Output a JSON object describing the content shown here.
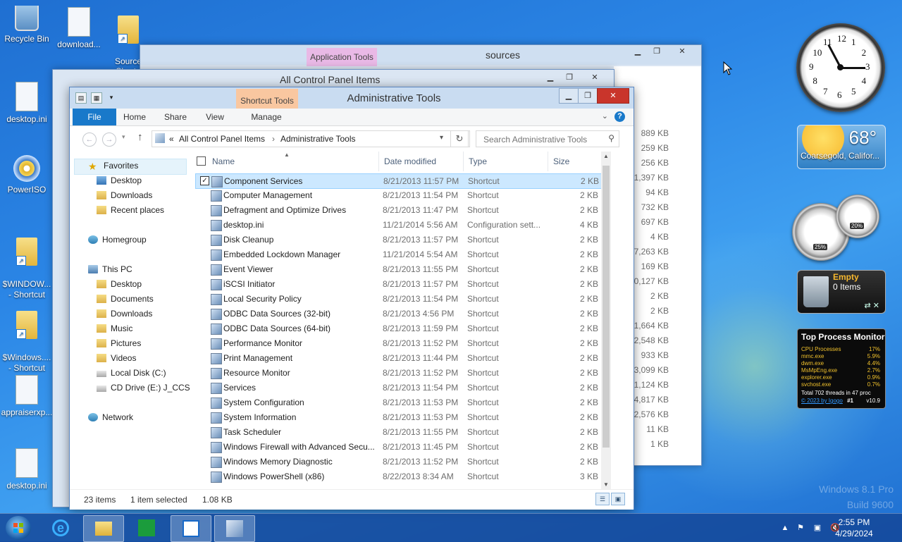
{
  "desktop": {
    "icons": [
      {
        "label": "Recycle Bin"
      },
      {
        "label": "download..."
      },
      {
        "label": "Source\nShorto"
      },
      {
        "label": "desktop.ini"
      },
      {
        "label": "PowerISO"
      },
      {
        "label": "$WINDOW...\n- Shortcut"
      },
      {
        "label": "$Windows....\n- Shortcut"
      },
      {
        "label": "appraiserxp..."
      },
      {
        "label": "desktop.ini"
      }
    ],
    "watermark_line1": "Windows 8.1 Pro",
    "watermark_line2": "Build 9600"
  },
  "bg_window_sources": {
    "tool_tab": "Application Tools",
    "title": "sources",
    "sizes": [
      "889 KB",
      "259 KB",
      "256 KB",
      "1,397 KB",
      "94 KB",
      "732 KB",
      "697 KB",
      "4 KB",
      "7,263 KB",
      "169 KB",
      "10,127 KB",
      "2 KB",
      "2 KB",
      "1,664 KB",
      "2,548 KB",
      "933 KB",
      "3,099 KB",
      "1,124 KB",
      "4,817 KB",
      "2,576 KB",
      "11 KB",
      "1 KB"
    ]
  },
  "bg_window_cp": {
    "title": "All Control Panel Items"
  },
  "main_window": {
    "tool_tab": "Shortcut Tools",
    "title": "Administrative Tools",
    "ribbon": {
      "file": "File",
      "home": "Home",
      "share": "Share",
      "view": "View",
      "manage": "Manage"
    },
    "address": {
      "prefix": "«",
      "crumb1": "All Control Panel Items",
      "sep": "›",
      "crumb2": "Administrative Tools"
    },
    "search_placeholder": "Search Administrative Tools",
    "nav": {
      "favorites": "Favorites",
      "desktop": "Desktop",
      "downloads": "Downloads",
      "recent": "Recent places",
      "homegroup": "Homegroup",
      "thispc": "This PC",
      "pc_desktop": "Desktop",
      "pc_documents": "Documents",
      "pc_downloads": "Downloads",
      "pc_music": "Music",
      "pc_pictures": "Pictures",
      "pc_videos": "Videos",
      "localdisk": "Local Disk (C:)",
      "cddrive": "CD Drive (E:) J_CCSA",
      "network": "Network"
    },
    "columns": {
      "name": "Name",
      "date": "Date modified",
      "type": "Type",
      "size": "Size"
    },
    "files": [
      {
        "name": "Component Services",
        "date": "8/21/2013 11:57 PM",
        "type": "Shortcut",
        "size": "2 KB",
        "selected": true
      },
      {
        "name": "Computer Management",
        "date": "8/21/2013 11:54 PM",
        "type": "Shortcut",
        "size": "2 KB"
      },
      {
        "name": "Defragment and Optimize Drives",
        "date": "8/21/2013 11:47 PM",
        "type": "Shortcut",
        "size": "2 KB"
      },
      {
        "name": "desktop.ini",
        "date": "11/21/2014 5:56 AM",
        "type": "Configuration sett...",
        "size": "4 KB"
      },
      {
        "name": "Disk Cleanup",
        "date": "8/21/2013 11:57 PM",
        "type": "Shortcut",
        "size": "2 KB"
      },
      {
        "name": "Embedded Lockdown Manager",
        "date": "11/21/2014 5:54 AM",
        "type": "Shortcut",
        "size": "2 KB"
      },
      {
        "name": "Event Viewer",
        "date": "8/21/2013 11:55 PM",
        "type": "Shortcut",
        "size": "2 KB"
      },
      {
        "name": "iSCSI Initiator",
        "date": "8/21/2013 11:57 PM",
        "type": "Shortcut",
        "size": "2 KB"
      },
      {
        "name": "Local Security Policy",
        "date": "8/21/2013 11:54 PM",
        "type": "Shortcut",
        "size": "2 KB"
      },
      {
        "name": "ODBC Data Sources (32-bit)",
        "date": "8/21/2013 4:56 PM",
        "type": "Shortcut",
        "size": "2 KB"
      },
      {
        "name": "ODBC Data Sources (64-bit)",
        "date": "8/21/2013 11:59 PM",
        "type": "Shortcut",
        "size": "2 KB"
      },
      {
        "name": "Performance Monitor",
        "date": "8/21/2013 11:52 PM",
        "type": "Shortcut",
        "size": "2 KB"
      },
      {
        "name": "Print Management",
        "date": "8/21/2013 11:44 PM",
        "type": "Shortcut",
        "size": "2 KB"
      },
      {
        "name": "Resource Monitor",
        "date": "8/21/2013 11:52 PM",
        "type": "Shortcut",
        "size": "2 KB"
      },
      {
        "name": "Services",
        "date": "8/21/2013 11:54 PM",
        "type": "Shortcut",
        "size": "2 KB"
      },
      {
        "name": "System Configuration",
        "date": "8/21/2013 11:53 PM",
        "type": "Shortcut",
        "size": "2 KB"
      },
      {
        "name": "System Information",
        "date": "8/21/2013 11:53 PM",
        "type": "Shortcut",
        "size": "2 KB"
      },
      {
        "name": "Task Scheduler",
        "date": "8/21/2013 11:55 PM",
        "type": "Shortcut",
        "size": "2 KB"
      },
      {
        "name": "Windows Firewall with Advanced Secu...",
        "date": "8/21/2013 11:45 PM",
        "type": "Shortcut",
        "size": "2 KB"
      },
      {
        "name": "Windows Memory Diagnostic",
        "date": "8/21/2013 11:52 PM",
        "type": "Shortcut",
        "size": "2 KB"
      },
      {
        "name": "Windows PowerShell (x86)",
        "date": "8/22/2013 8:34 AM",
        "type": "Shortcut",
        "size": "3 KB"
      }
    ],
    "status": {
      "count": "23 items",
      "selection": "1 item selected",
      "size": "1.08 KB"
    }
  },
  "gadgets": {
    "clock_numbers": [
      "12",
      "1",
      "2",
      "3",
      "4",
      "5",
      "6",
      "7",
      "8",
      "9",
      "10",
      "11"
    ],
    "weather": {
      "temp": "68°",
      "city": "Coarsegold, Califor..."
    },
    "meter_cpu": "25%",
    "meter_mem": "20%",
    "recycle": {
      "state": "Empty",
      "items": "0 Items"
    },
    "tpm": {
      "title": "Top Process Monitor",
      "rows": [
        {
          "name": "CPU Processes",
          "val": "17%"
        },
        {
          "name": "mmc.exe",
          "val": "5.9%"
        },
        {
          "name": "dwm.exe",
          "val": "4.4%"
        },
        {
          "name": "MsMpEng.exe",
          "val": "2.7%"
        },
        {
          "name": "explorer.exe",
          "val": "0.9%"
        },
        {
          "name": "svchost.exe",
          "val": "0.7%"
        }
      ],
      "threads": "Total 702 threads in 47 proc",
      "link": "© 2023 by Igogo",
      "rank": "#1",
      "version": "v10.9"
    }
  },
  "taskbar": {
    "time": "2:55 PM",
    "date": "4/29/2024"
  }
}
